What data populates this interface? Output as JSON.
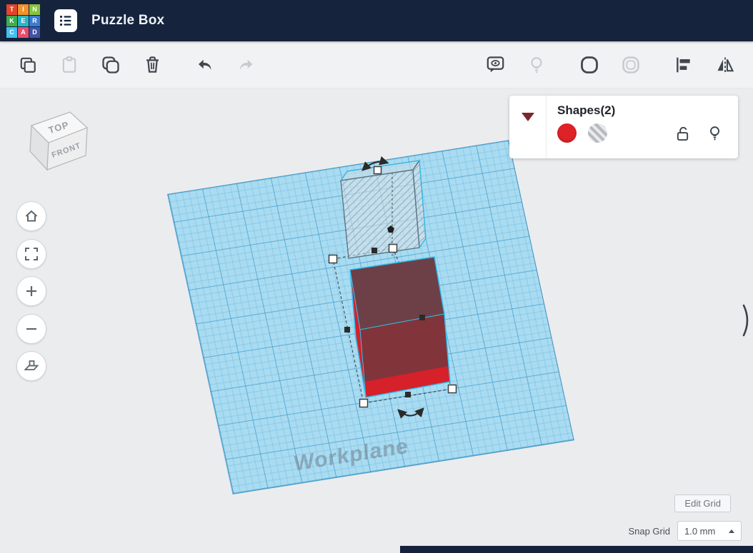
{
  "header": {
    "title": "Puzzle Box"
  },
  "logo": {
    "letters": [
      "T",
      "I",
      "N",
      "K",
      "E",
      "R",
      "C",
      "A",
      "D"
    ],
    "tile_colors": [
      "#e2452d",
      "#f0932c",
      "#86c440",
      "#3aaf4c",
      "#2ab5c8",
      "#3a7bd5",
      "#41c0f0",
      "#e84e6f",
      "#4153a5"
    ]
  },
  "toolbar": {
    "left_buttons": [
      {
        "name": "copy",
        "enabled": true
      },
      {
        "name": "paste",
        "enabled": false
      },
      {
        "name": "duplicate",
        "enabled": true
      },
      {
        "name": "delete",
        "enabled": true
      },
      {
        "name": "undo",
        "enabled": true
      },
      {
        "name": "redo",
        "enabled": false
      }
    ],
    "right_buttons": [
      {
        "name": "notes",
        "enabled": true
      },
      {
        "name": "tips",
        "enabled": false
      },
      {
        "name": "solid",
        "enabled": true
      },
      {
        "name": "hole",
        "enabled": false
      },
      {
        "name": "align",
        "enabled": true
      },
      {
        "name": "mirror",
        "enabled": true
      }
    ]
  },
  "viewcube": {
    "top_label": "TOP",
    "front_label": "FRONT"
  },
  "canvas": {
    "workplane_label": "Workplane"
  },
  "inspector": {
    "title": "Shapes(2)",
    "selected_count": 2,
    "swatches": [
      "red",
      "striped"
    ],
    "icons": [
      "unlock",
      "show-hide"
    ]
  },
  "footer": {
    "edit_grid_label": "Edit Grid",
    "snap_grid_label": "Snap Grid",
    "snap_value": "1.0 mm"
  },
  "colors": {
    "header_bg": "#15233d",
    "selection_cyan": "#2fc1f0",
    "shape_red": "#d6202a",
    "shape_top_face": "#6d4048",
    "workplane_blue": "#a9dbf1"
  }
}
